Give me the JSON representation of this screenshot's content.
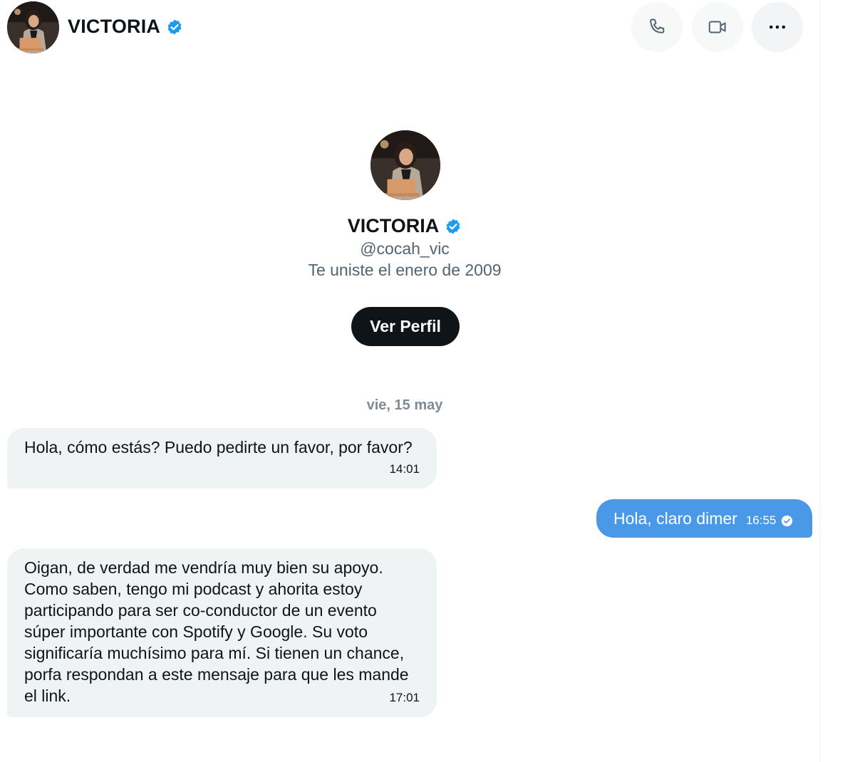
{
  "header": {
    "name": "VICTORIA",
    "icons": {
      "verified": "verified-badge-icon",
      "call": "phone-icon",
      "video": "video-camera-icon",
      "more": "more-options-icon"
    }
  },
  "profile": {
    "name": "VICTORIA",
    "handle": "@cocah_vic",
    "joined": "Te uniste el enero de 2009",
    "button_label": "Ver Perfil"
  },
  "conversation": {
    "date_separator": "vie, 15 may",
    "messages": [
      {
        "direction": "incoming",
        "text": "Hola, cómo estás? Puedo pedirte un favor, por favor?",
        "time": "14:01"
      },
      {
        "direction": "outgoing",
        "text": "Hola, claro dimer",
        "time": "16:55",
        "status_icon": "read-check-icon"
      },
      {
        "direction": "incoming",
        "text": "Oigan, de verdad me vendría muy bien su apoyo. Como saben, tengo mi podcast y ahorita estoy participando para ser co-conductor de un evento súper importante con Spotify y Google. Su voto significaría muchísimo para mí. Si tienen un chance, porfa respondan a este mensaje para que les mande el link.",
        "time": "17:01"
      }
    ]
  },
  "colors": {
    "verified_blue": "#1d9bf0",
    "outgoing_bubble": "#4a99e9",
    "incoming_bubble": "#eff3f4",
    "button_dark": "#0f1419",
    "secondary_text": "#536471"
  }
}
